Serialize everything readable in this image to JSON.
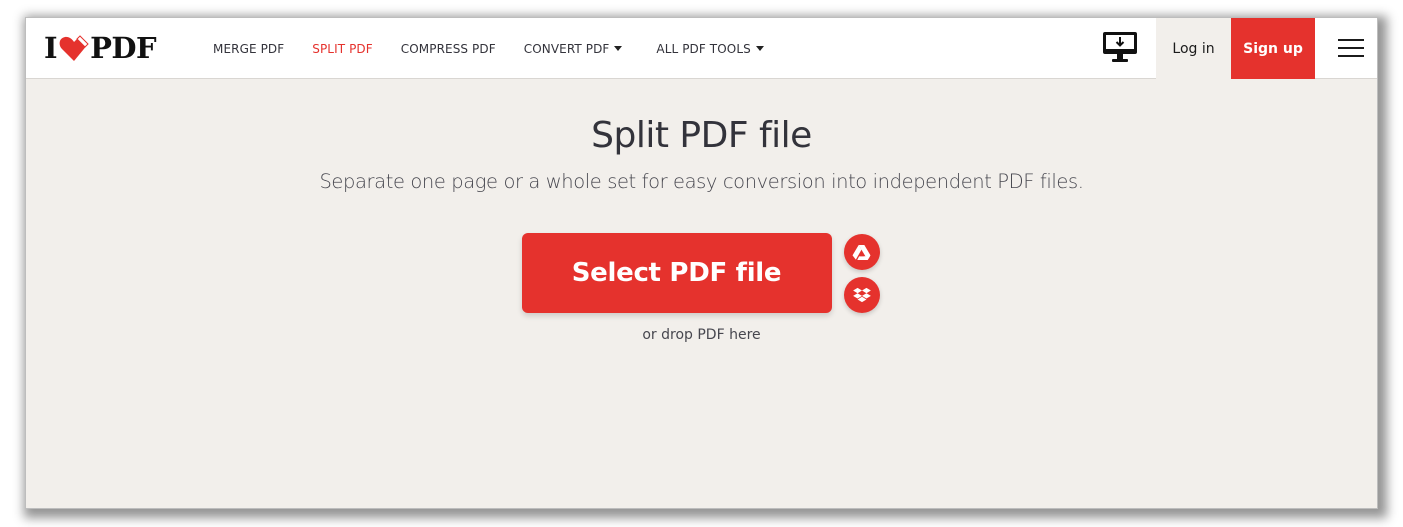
{
  "brand": {
    "logo_left": "I",
    "logo_right": "PDF",
    "logo_icon": "heart-page-icon",
    "accent_color": "#e5322d"
  },
  "nav": {
    "items": [
      {
        "label": "MERGE PDF",
        "active": false,
        "dropdown": false
      },
      {
        "label": "SPLIT PDF",
        "active": true,
        "dropdown": false
      },
      {
        "label": "COMPRESS PDF",
        "active": false,
        "dropdown": false
      },
      {
        "label": "CONVERT PDF",
        "active": false,
        "dropdown": true
      },
      {
        "label": "ALL PDF TOOLS",
        "active": false,
        "dropdown": true
      }
    ]
  },
  "header_actions": {
    "desktop_icon": "desktop-download-icon",
    "login_label": "Log in",
    "signup_label": "Sign up",
    "menu_icon": "hamburger-menu-icon"
  },
  "main": {
    "title": "Split PDF file",
    "subtitle": "Separate one page or a whole set for easy conversion into independent PDF files.",
    "select_button_label": "Select PDF file",
    "cloud_sources": [
      {
        "name": "Google Drive",
        "icon": "google-drive-icon"
      },
      {
        "name": "Dropbox",
        "icon": "dropbox-icon"
      }
    ],
    "drop_hint": "or drop PDF here"
  }
}
